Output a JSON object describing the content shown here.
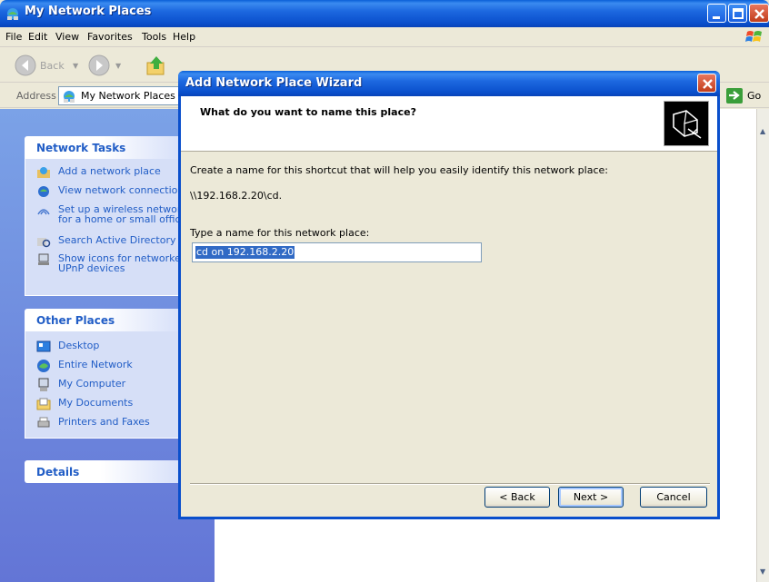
{
  "window": {
    "title": "My Network Places"
  },
  "menu": [
    "File",
    "Edit",
    "View",
    "Favorites",
    "Tools",
    "Help"
  ],
  "toolbar": {
    "back_label": "Back"
  },
  "address": {
    "label": "Address",
    "value": "My Network Places",
    "go_label": "Go"
  },
  "network_tasks": {
    "title": "Network Tasks",
    "items": [
      "Add a network place",
      "View network connections",
      "Set up a wireless network",
      "for a home or small office",
      "Search Active Directory",
      "Show icons for networked",
      "UPnP devices"
    ]
  },
  "other_places": {
    "title": "Other Places",
    "items": [
      "Desktop",
      "Entire Network",
      "My Computer",
      "My Documents",
      "Printers and Faxes"
    ]
  },
  "details": {
    "title": "Details"
  },
  "wizard": {
    "title": "Add Network Place Wizard",
    "question": "What do you want to name this place?",
    "description": "Create a name for this shortcut that will help you easily identify this network place:",
    "path": "\\\\192.168.2.20\\cd.",
    "field_label": "Type a name for this network place:",
    "field_value": "cd on 192.168.2.20",
    "back_button": "< Back",
    "next_button": "Next >",
    "cancel_button": "Cancel"
  },
  "colors": {
    "title_blue": "#0a4fcc",
    "link_blue": "#215dc6",
    "pane_blue": "#7ba2e7",
    "selection": "#316ac5"
  }
}
